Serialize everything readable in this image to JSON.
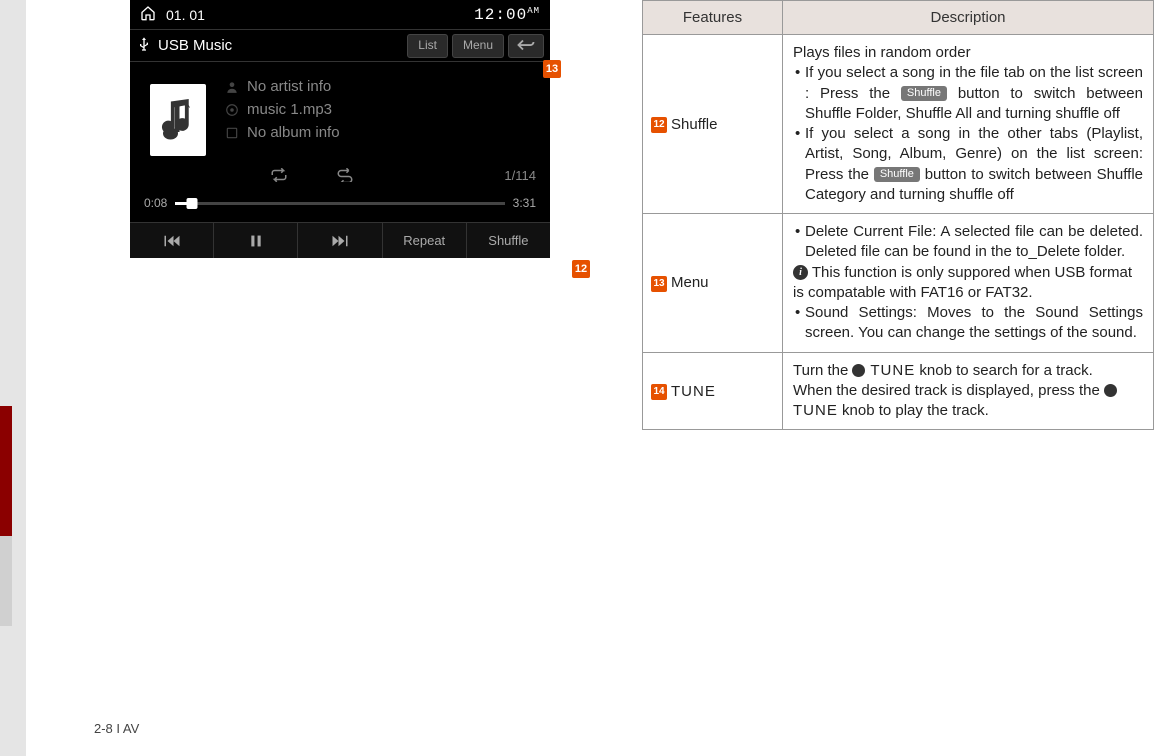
{
  "screenshot": {
    "topbar": {
      "date": "01. 01",
      "time": "12:00",
      "ampm": "AM"
    },
    "header": {
      "title": "USB Music",
      "list_btn": "List",
      "menu_btn": "Menu"
    },
    "info": {
      "artist": "No artist info",
      "track": "music 1.mp3",
      "album": "No album info"
    },
    "count": "1/114",
    "progress": {
      "elapsed": "0:08",
      "total": "3:31"
    },
    "bottom": {
      "repeat": "Repeat",
      "shuffle": "Shuffle"
    }
  },
  "callouts": {
    "c12": "12",
    "c13": "13"
  },
  "table": {
    "headers": {
      "features": "Features",
      "description": "Description"
    },
    "rows": {
      "shuffle": {
        "num": "12",
        "label": "Shuffle",
        "desc_lead": "Plays files in random order",
        "li1_a": "If you select a song in the file tab on the list screen : Press the ",
        "li1_pill": "Shuffle",
        "li1_b": " button to switch between Shuffle Folder, Shuffle All and turning shuffle off",
        "li2_a": "If you select a song in the other tabs (Playlist, Artist, Song, Album, Genre) on the list screen: Press the ",
        "li2_pill": "Shuffle",
        "li2_b": " button to switch between Shuffle Category and turning shuffle off"
      },
      "menu": {
        "num": "13",
        "label": "Menu",
        "li1": "Delete Current File: A selected file can be deleted. Deleted file can be found in the to_Delete folder.",
        "note_a": " This function is only suppored when USB format is compatable with FAT16 or FAT32.",
        "li2": "Sound Settings: Moves to the Sound Settings screen. You can change the settings of the sound."
      },
      "tune": {
        "num": "14",
        "label": "TUNE",
        "l1_a": "Turn the ",
        "l1_tune": " TUNE",
        "l1_b": " knob to search for a track.",
        "l2_a": "When the desired track is displayed, press the ",
        "l2_tune": " TUNE",
        "l2_b": " knob to play the track."
      }
    }
  },
  "page_num": "2-8 I AV"
}
